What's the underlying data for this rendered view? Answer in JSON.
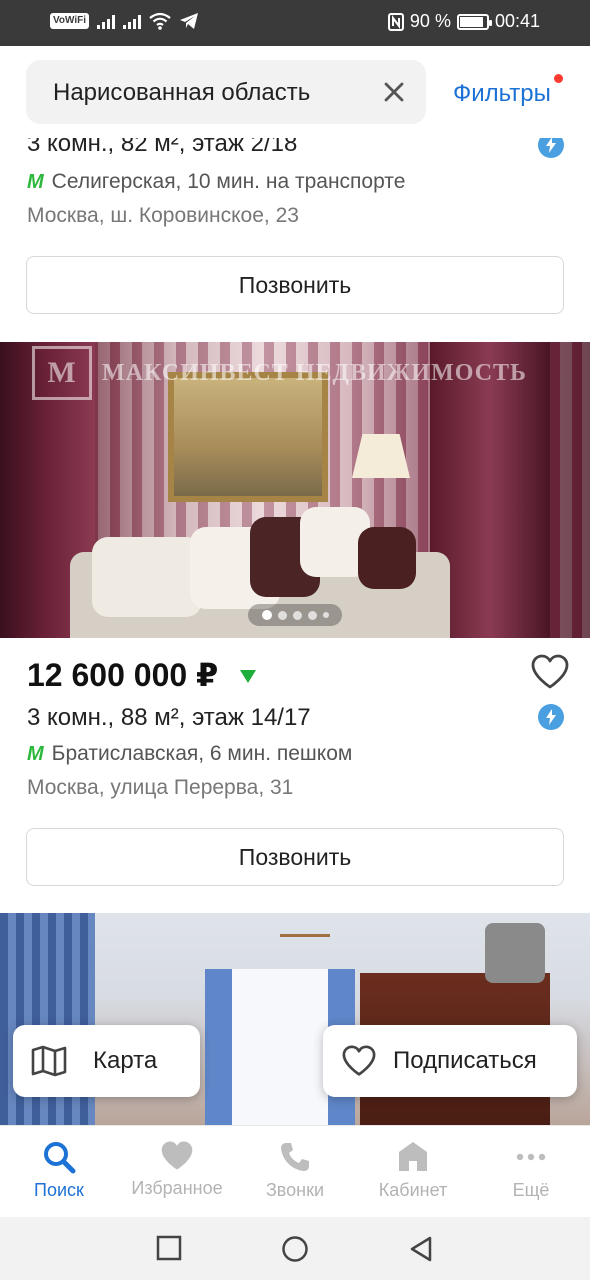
{
  "status_bar": {
    "vowifi": "VoWiFi",
    "battery": "90 %",
    "battery_level": 0.9,
    "time": "00:41"
  },
  "search": {
    "text": "Нарисованная область",
    "filters_label": "Фильтры",
    "filters_badge_color": "#ff3b30"
  },
  "listings": [
    {
      "params": "3 комн., 82 м², этаж 2/18",
      "metro": "Селигерская, 10 мин. на транспорте",
      "address": "Москва, ш. Коровинское, 23",
      "call_label": "Позвонить"
    },
    {
      "watermark": "МАКСИНВЕСТ НЕДВИЖИМОСТЬ",
      "photo_count": 5,
      "photo_index": 1,
      "price": "12 600 000 ₽",
      "params": "3 комн., 88 м², этаж 14/17",
      "metro": "Братиславская, 6 мин. пешком",
      "address": "Москва, улица Перерва, 31",
      "call_label": "Позвонить"
    }
  ],
  "floating": {
    "map_label": "Карта",
    "subscribe_label": "Подписаться"
  },
  "tabs": [
    {
      "label": "Поиск",
      "icon": "search-icon",
      "active": true
    },
    {
      "label": "Избранное",
      "icon": "heart-icon",
      "active": false
    },
    {
      "label": "Звонки",
      "icon": "phone-icon",
      "active": false
    },
    {
      "label": "Кабинет",
      "icon": "home-icon",
      "active": false
    },
    {
      "label": "Ещё",
      "icon": "more-icon",
      "active": false
    }
  ],
  "colors": {
    "accent": "#1d72d6",
    "metro": "#2db83d",
    "price_down": "#1fae3a",
    "flash": "#4a9fe0"
  }
}
